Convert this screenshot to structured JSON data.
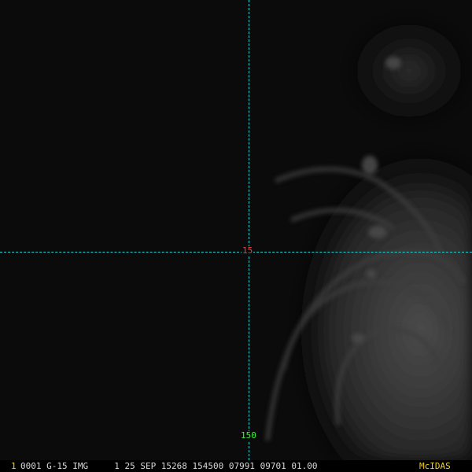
{
  "grid": {
    "latitude_label": "15",
    "longitude_label": "150",
    "line_color": "#2ad0d0",
    "lat_color": "#ff3b3b",
    "lon_color": "#3ef03e"
  },
  "status_bar": {
    "frame_number": "1",
    "text": "0001 G-15 IMG     1 25 SEP 15268 154500 07991 09701 01.00",
    "brand": "McIDAS"
  }
}
